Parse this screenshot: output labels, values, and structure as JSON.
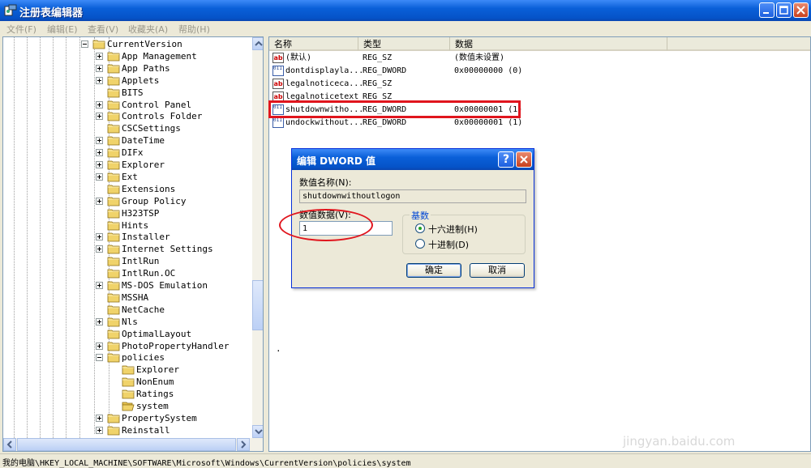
{
  "window": {
    "title": "注册表编辑器"
  },
  "menu": [
    "文件(F)",
    "编辑(E)",
    "查看(V)",
    "收藏夹(A)",
    "帮助(H)"
  ],
  "tree": {
    "items": [
      {
        "label": "CurrentVersion",
        "depth": 0,
        "expander": "minus"
      },
      {
        "label": "App Management",
        "depth": 1,
        "expander": "plus"
      },
      {
        "label": "App Paths",
        "depth": 1,
        "expander": "plus"
      },
      {
        "label": "Applets",
        "depth": 1,
        "expander": "plus"
      },
      {
        "label": "BITS",
        "depth": 1,
        "expander": "none"
      },
      {
        "label": "Control Panel",
        "depth": 1,
        "expander": "plus"
      },
      {
        "label": "Controls Folder",
        "depth": 1,
        "expander": "plus"
      },
      {
        "label": "CSCSettings",
        "depth": 1,
        "expander": "none"
      },
      {
        "label": "DateTime",
        "depth": 1,
        "expander": "plus"
      },
      {
        "label": "DIFx",
        "depth": 1,
        "expander": "plus"
      },
      {
        "label": "Explorer",
        "depth": 1,
        "expander": "plus"
      },
      {
        "label": "Ext",
        "depth": 1,
        "expander": "plus"
      },
      {
        "label": "Extensions",
        "depth": 1,
        "expander": "none"
      },
      {
        "label": "Group Policy",
        "depth": 1,
        "expander": "plus"
      },
      {
        "label": "H323TSP",
        "depth": 1,
        "expander": "none"
      },
      {
        "label": "Hints",
        "depth": 1,
        "expander": "none"
      },
      {
        "label": "Installer",
        "depth": 1,
        "expander": "plus"
      },
      {
        "label": "Internet Settings",
        "depth": 1,
        "expander": "plus"
      },
      {
        "label": "IntlRun",
        "depth": 1,
        "expander": "none"
      },
      {
        "label": "IntlRun.OC",
        "depth": 1,
        "expander": "none"
      },
      {
        "label": "MS-DOS Emulation",
        "depth": 1,
        "expander": "plus"
      },
      {
        "label": "MSSHA",
        "depth": 1,
        "expander": "none"
      },
      {
        "label": "NetCache",
        "depth": 1,
        "expander": "none"
      },
      {
        "label": "Nls",
        "depth": 1,
        "expander": "plus"
      },
      {
        "label": "OptimalLayout",
        "depth": 1,
        "expander": "none"
      },
      {
        "label": "PhotoPropertyHandler",
        "depth": 1,
        "expander": "plus"
      },
      {
        "label": "policies",
        "depth": 1,
        "expander": "minus"
      },
      {
        "label": "Explorer",
        "depth": 2,
        "expander": "none"
      },
      {
        "label": "NonEnum",
        "depth": 2,
        "expander": "none"
      },
      {
        "label": "Ratings",
        "depth": 2,
        "expander": "none"
      },
      {
        "label": "system",
        "depth": 2,
        "expander": "none",
        "open": true
      },
      {
        "label": "PropertySystem",
        "depth": 1,
        "expander": "plus"
      },
      {
        "label": "Reinstall",
        "depth": 1,
        "expander": "plus"
      }
    ]
  },
  "list": {
    "columns": [
      "名称",
      "类型",
      "数据"
    ],
    "rows": [
      {
        "icon": "string-value-icon",
        "name": "(默认)",
        "type": "REG_SZ",
        "data": "(数值未设置)"
      },
      {
        "icon": "binary-value-icon",
        "name": "dontdisplayla...",
        "type": "REG_DWORD",
        "data": "0x00000000 (0)"
      },
      {
        "icon": "string-value-icon",
        "name": "legalnoticeca...",
        "type": "REG_SZ",
        "data": ""
      },
      {
        "icon": "string-value-icon",
        "name": "legalnoticetext",
        "type": "REG_SZ",
        "data": ""
      },
      {
        "icon": "binary-value-icon",
        "name": "shutdownwitho...",
        "type": "REG_DWORD",
        "data": "0x00000001 (1)"
      },
      {
        "icon": "binary-value-icon",
        "name": "undockwithout...",
        "type": "REG_DWORD",
        "data": "0x00000001 (1)"
      }
    ],
    "stray_dot": "."
  },
  "dialog": {
    "title": "编辑 DWORD 值",
    "help_label": "?",
    "value_name_label": "数值名称(N):",
    "value_name": "shutdownwithoutlogon",
    "value_data_label": "数值数据(V):",
    "value_data": "1",
    "base_legend": "基数",
    "hex_label": "十六进制(H)",
    "dec_label": "十进制(D)",
    "ok_label": "确定",
    "cancel_label": "取消"
  },
  "status": {
    "path": "我的电脑\\HKEY_LOCAL_MACHINE\\SOFTWARE\\Microsoft\\Windows\\CurrentVersion\\policies\\system"
  },
  "watermark": "jingyan.baidu.com",
  "colors": {
    "titlebar": "#0a5fd8",
    "annotation": "#e0151d",
    "folder": "#f0d36a"
  }
}
